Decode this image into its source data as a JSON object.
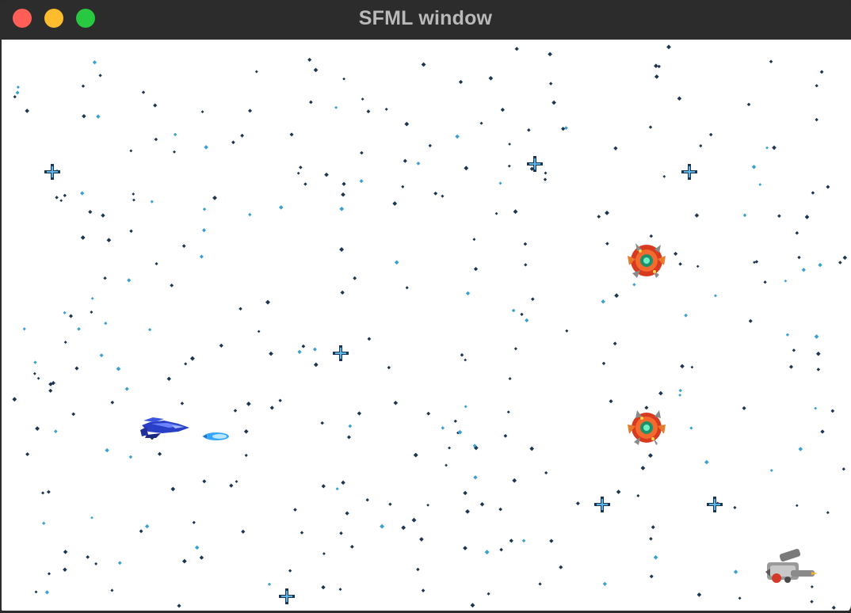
{
  "window": {
    "title": "SFML window",
    "traffic_lights": [
      {
        "name": "close-button",
        "color": "#ff5f57"
      },
      {
        "name": "minimize-button",
        "color": "#febc2e"
      },
      {
        "name": "maximize-button",
        "color": "#28c840"
      }
    ]
  },
  "game": {
    "background": "#ffffff",
    "star_color": "#1c3550",
    "star_highlight": "#3aa0d0",
    "sprites": [
      {
        "name": "player-ship-sprite",
        "kind": "player ship"
      },
      {
        "name": "player-bullet-sprite",
        "kind": "plasma shot"
      },
      {
        "name": "enemy-sprite-1",
        "kind": "red orb enemy"
      },
      {
        "name": "enemy-sprite-2",
        "kind": "red orb enemy"
      },
      {
        "name": "turret-sprite",
        "kind": "gray turret"
      }
    ]
  }
}
